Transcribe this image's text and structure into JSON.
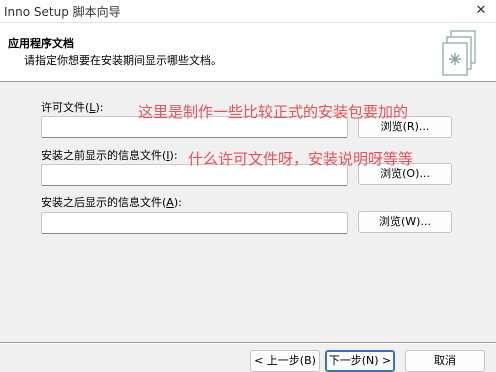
{
  "window": {
    "title": "Inno Setup 脚本向导",
    "close_glyph": "✕"
  },
  "header": {
    "title": "应用程序文档",
    "description": "请指定你想要在安装期间显示哪些文档。",
    "icon": "setup-wizard-icon"
  },
  "fields": [
    {
      "label": "许可文件(",
      "accel": "L",
      "label_end": "):",
      "value": "",
      "browse_label": "浏览(R)..."
    },
    {
      "label": "安装之前显示的信息文件(",
      "accel": "I",
      "label_end": "):",
      "value": "",
      "browse_label": "浏览(O)..."
    },
    {
      "label": "安装之后显示的信息文件(",
      "accel": "A",
      "label_end": "):",
      "value": "",
      "browse_label": "浏览(W)..."
    }
  ],
  "annotations": {
    "line1": "这里是制作一些比较正式的安装包要加的",
    "line2": "什么许可文件呀，安装说明呀等等",
    "color": "#e8525a"
  },
  "buttons": {
    "back": "< 上一步(B)",
    "next": "下一步(N) >",
    "cancel": "取消"
  }
}
